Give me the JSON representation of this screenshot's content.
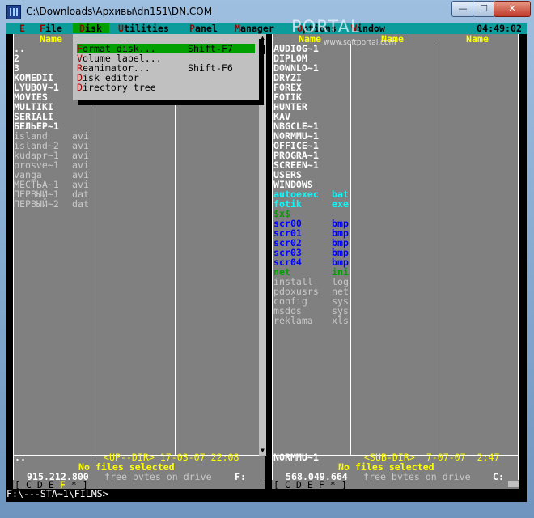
{
  "window": {
    "title": "C:\\Downloads\\Архивы\\dn151\\DN.COM",
    "minimize": "—",
    "maximize": "☐",
    "close": "✕",
    "watermark": "PORTAL",
    "watermark_sub": "www.softportal.com"
  },
  "menubar": {
    "items": [
      {
        "hot": "E",
        "rest": ""
      },
      {
        "hot": "F",
        "rest": "ile"
      },
      {
        "hot": "D",
        "rest": "isk"
      },
      {
        "hot": "U",
        "rest": "tilities"
      },
      {
        "hot": "P",
        "rest": "anel"
      },
      {
        "hot": "M",
        "rest": "anager"
      },
      {
        "hot": "O",
        "rest": "ptions"
      },
      {
        "hot": "W",
        "rest": "indow"
      }
    ],
    "clock": "04:49:02"
  },
  "disk_menu": {
    "items": [
      {
        "hot": "F",
        "rest": "ormat disk...",
        "shortcut": "Shift-F7"
      },
      {
        "hot": "V",
        "rest": "olume label...",
        "shortcut": ""
      },
      {
        "hot": "R",
        "rest": "eanimator...",
        "shortcut": "Shift-F6"
      },
      {
        "hot": "D",
        "rest": "isk editor",
        "shortcut": ""
      },
      {
        "hot": "D",
        "rest": "irectory tree",
        "shortcut": ""
      }
    ]
  },
  "left_panel": {
    "col_header": "Name",
    "files": [
      {
        "name": "..",
        "ext": "",
        "style": "dir"
      },
      {
        "name": "2",
        "ext": "",
        "style": "dir"
      },
      {
        "name": "3",
        "ext": "",
        "style": "dir"
      },
      {
        "name": "KOMEDII",
        "ext": "",
        "style": "dir"
      },
      {
        "name": "LYUBOV~1",
        "ext": "",
        "style": "dir"
      },
      {
        "name": "MOVIES",
        "ext": "",
        "style": "dir"
      },
      {
        "name": "MULTIKI",
        "ext": "",
        "style": "dir"
      },
      {
        "name": "SERIALI",
        "ext": "",
        "style": "dir"
      },
      {
        "name": "БЕЛЬЕР~1",
        "ext": "",
        "style": "dir"
      },
      {
        "name": "island",
        "ext": "avi",
        "style": "dim"
      },
      {
        "name": "island~2",
        "ext": "avi",
        "style": "dim"
      },
      {
        "name": "kudapr~1",
        "ext": "avi",
        "style": "dim"
      },
      {
        "name": "prosve~1",
        "ext": "avi",
        "style": "dim"
      },
      {
        "name": "vanga",
        "ext": "avi",
        "style": "dim"
      },
      {
        "name": "МЕСТЬА~1",
        "ext": "avi",
        "style": "dim"
      },
      {
        "name": "ПЕРВЫЙ~1",
        "ext": "dat",
        "style": "dim"
      },
      {
        "name": "ПЕРВЫЙ~2",
        "ext": "dat",
        "style": "dim"
      }
    ],
    "status_name": "..",
    "status_info": "<UP--DIR> 17-03-07 22:08",
    "selection": "No files selected",
    "free_bytes": "915,212,800",
    "free_label": "free bytes on drive",
    "drive": "F:",
    "drives": "[ C D E F * ]",
    "active_drive": "F"
  },
  "right_panel": {
    "col_header": "Name",
    "files": [
      {
        "name": "AUDIOG~1",
        "ext": "",
        "style": "dir"
      },
      {
        "name": "DIPLOM",
        "ext": "",
        "style": "dir"
      },
      {
        "name": "DOWNLO~1",
        "ext": "",
        "style": "dir"
      },
      {
        "name": "DRYZI",
        "ext": "",
        "style": "dir"
      },
      {
        "name": "FOREX",
        "ext": "",
        "style": "dir"
      },
      {
        "name": "FOTIK",
        "ext": "",
        "style": "dir"
      },
      {
        "name": "HUNTER",
        "ext": "",
        "style": "dir"
      },
      {
        "name": "KAV",
        "ext": "",
        "style": "dir"
      },
      {
        "name": "NBGCLE~1",
        "ext": "",
        "style": "dir"
      },
      {
        "name": "NORMMU~1",
        "ext": "",
        "style": "dir"
      },
      {
        "name": "OFFICE~1",
        "ext": "",
        "style": "dir"
      },
      {
        "name": "PROGRA~1",
        "ext": "",
        "style": "dir"
      },
      {
        "name": "SCREEN~1",
        "ext": "",
        "style": "dir"
      },
      {
        "name": "USERS",
        "ext": "",
        "style": "dir"
      },
      {
        "name": "WINDOWS",
        "ext": "",
        "style": "dir"
      },
      {
        "name": "autoexec",
        "ext": "bat",
        "style": "cyan"
      },
      {
        "name": "fotik",
        "ext": "exe",
        "style": "cyan"
      },
      {
        "name": "$x$",
        "ext": "",
        "style": "green"
      },
      {
        "name": "scr00",
        "ext": "bmp",
        "style": "blue"
      },
      {
        "name": "scr01",
        "ext": "bmp",
        "style": "blue"
      },
      {
        "name": "scr02",
        "ext": "bmp",
        "style": "blue"
      },
      {
        "name": "scr03",
        "ext": "bmp",
        "style": "blue"
      },
      {
        "name": "scr04",
        "ext": "bmp",
        "style": "blue"
      },
      {
        "name": "net",
        "ext": "ini",
        "style": "green"
      },
      {
        "name": "install",
        "ext": "log",
        "style": "dim"
      },
      {
        "name": "pdoxusrs",
        "ext": "net",
        "style": "dim"
      },
      {
        "name": "config",
        "ext": "sys",
        "style": "dim"
      },
      {
        "name": "msdos",
        "ext": "sys",
        "style": "dim"
      },
      {
        "name": "reklama",
        "ext": "xls",
        "style": "dim"
      }
    ],
    "status_name": "NORMMU~1",
    "status_info": "<SUB-DIR>  7-07-07  2:47",
    "selection": "No files selected",
    "free_bytes": "568,049,664",
    "free_label": "free bytes on drive",
    "drive": "C:",
    "drives": "[ C D E F * ]"
  },
  "command_line": "F:\\---STA~1\\FILMS>"
}
